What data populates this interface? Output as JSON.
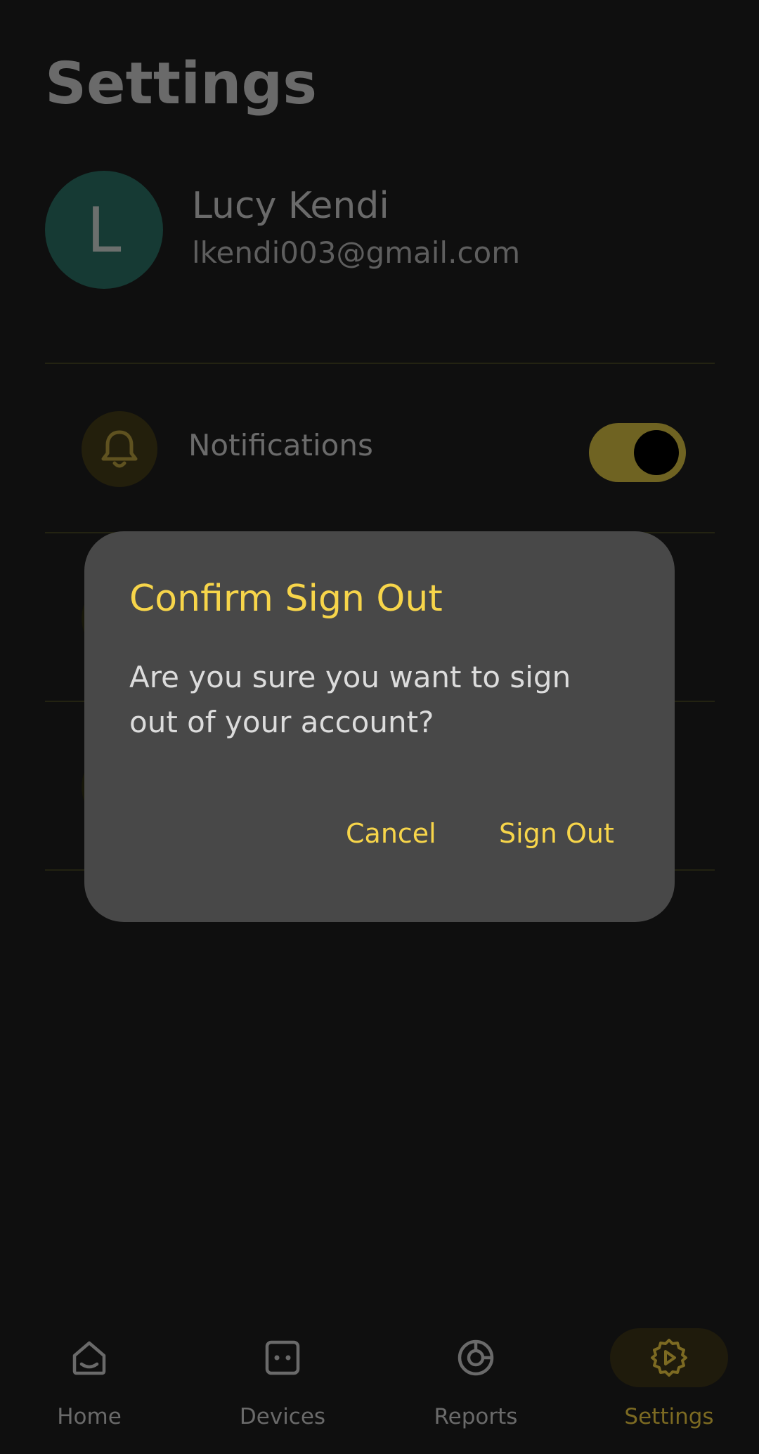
{
  "page": {
    "title": "Settings"
  },
  "profile": {
    "avatar_letter": "L",
    "name": "Lucy Kendi",
    "email": "lkendi003@gmail.com",
    "avatar_color": "#163a34"
  },
  "settings": {
    "notifications": {
      "label": "Notifications",
      "enabled": true
    }
  },
  "dialog": {
    "title": "Confirm Sign Out",
    "message": "Are you sure you want to sign out of your account?",
    "cancel_label": "Cancel",
    "confirm_label": "Sign Out"
  },
  "nav": {
    "items": [
      {
        "label": "Home",
        "icon": "home-icon",
        "active": false
      },
      {
        "label": "Devices",
        "icon": "devices-icon",
        "active": false
      },
      {
        "label": "Reports",
        "icon": "reports-icon",
        "active": false
      },
      {
        "label": "Settings",
        "icon": "settings-gear-icon",
        "active": true
      }
    ]
  },
  "colors": {
    "accent": "#f7d54a",
    "background": "#0f0f0f",
    "dialog_bg": "#484848"
  }
}
